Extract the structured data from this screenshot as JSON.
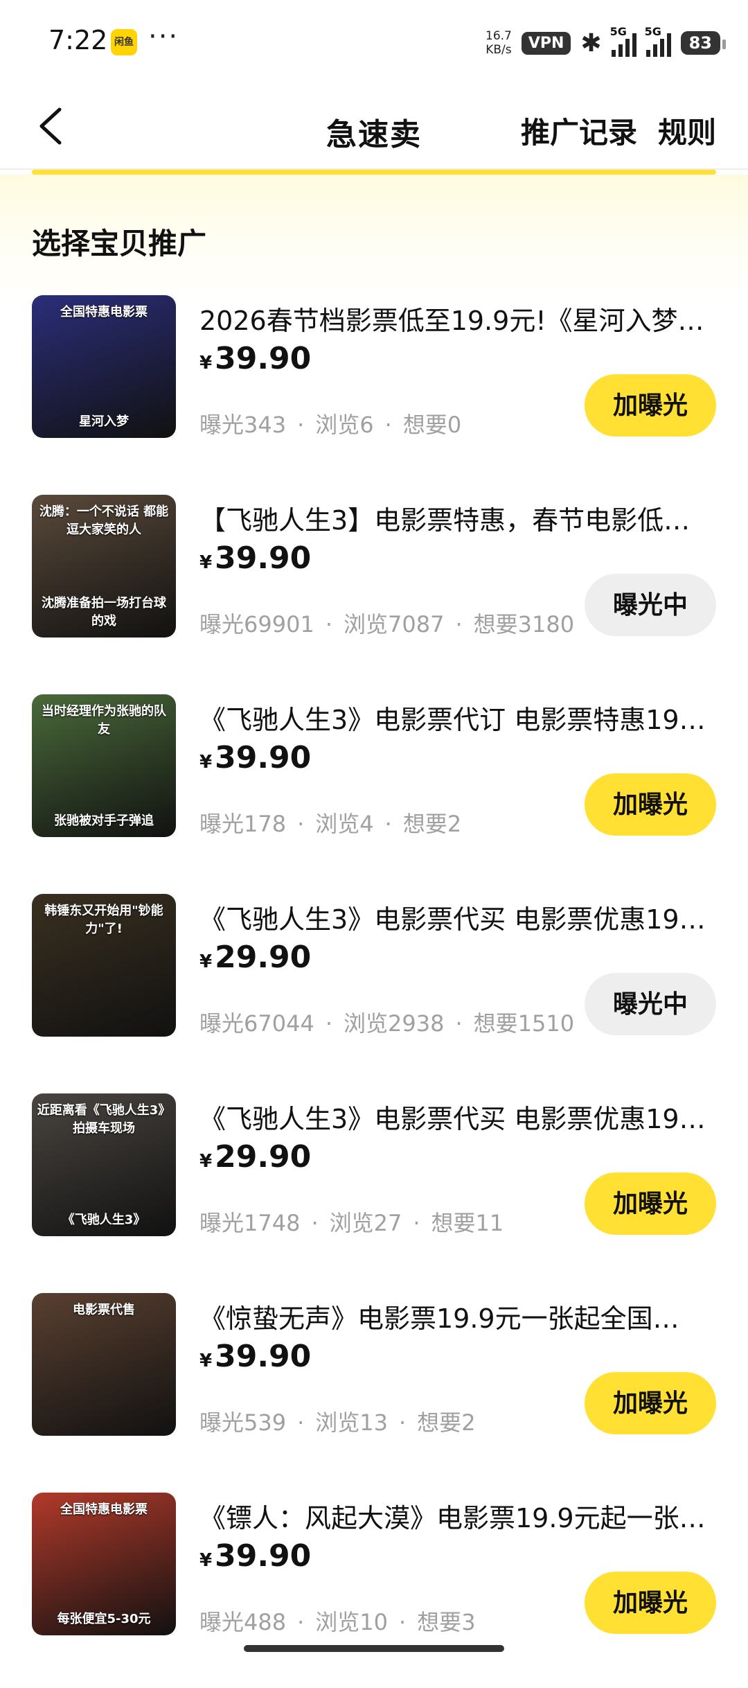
{
  "status_bar": {
    "time": "7:22",
    "app_icon_text": "闲鱼",
    "more": "···",
    "speed_value": "16.7",
    "speed_unit": "KB/s",
    "vpn": "VPN",
    "signal1_label": "5G",
    "signal2_label": "5G",
    "battery": "83"
  },
  "header": {
    "title": "急速卖",
    "link_records": "推广记录",
    "link_rules": "规则"
  },
  "section_title": "选择宝贝推广",
  "currency": "¥",
  "stat_labels": {
    "exposure": "曝光",
    "views": "浏览",
    "wants": "想要"
  },
  "dot": "·",
  "items": [
    {
      "title": "2026春节档影票低至19.9元!《星河入梦…",
      "price": "39.90",
      "exposure": "343",
      "views": "6",
      "wants": "0",
      "button": "加曝光",
      "button_state": "add",
      "thumb_caption_top": "全国特惠电影票",
      "thumb_caption_bottom": "星河入梦",
      "thumb_color": "#2b2e7a"
    },
    {
      "title": "【飞驰人生3】电影票特惠，春节电影低…",
      "price": "39.90",
      "exposure": "69901",
      "views": "7087",
      "wants": "3180",
      "button": "曝光中",
      "button_state": "running",
      "thumb_caption_top": "沈腾：一个不说话 都能逗大家笑的人",
      "thumb_caption_bottom": "沈腾准备拍一场打台球的戏",
      "thumb_color": "#5a4a3a"
    },
    {
      "title": "《飞驰人生3》电影票代订 电影票特惠19…",
      "price": "39.90",
      "exposure": "178",
      "views": "4",
      "wants": "2",
      "button": "加曝光",
      "button_state": "add",
      "thumb_caption_top": "当时经理作为张驰的队友",
      "thumb_caption_bottom": "张驰被对手子弹追",
      "thumb_color": "#4a6a3a"
    },
    {
      "title": "《飞驰人生3》电影票代买 电影票优惠19…",
      "price": "29.90",
      "exposure": "67044",
      "views": "2938",
      "wants": "1510",
      "button": "曝光中",
      "button_state": "running",
      "thumb_caption_top": "韩锤东又开始用\"钞能力\"了!",
      "thumb_caption_bottom": "",
      "thumb_color": "#3a3020"
    },
    {
      "title": "《飞驰人生3》电影票代买 电影票优惠19…",
      "price": "29.90",
      "exposure": "1748",
      "views": "27",
      "wants": "11",
      "button": "加曝光",
      "button_state": "add",
      "thumb_caption_top": "近距离看《飞驰人生3》拍摄车现场",
      "thumb_caption_bottom": "《飞驰人生3》",
      "thumb_color": "#4a4540"
    },
    {
      "title": "《惊蛰无声》电影票19.9元一张起全国…",
      "price": "39.90",
      "exposure": "539",
      "views": "13",
      "wants": "2",
      "button": "加曝光",
      "button_state": "add",
      "thumb_caption_top": "电影票代售",
      "thumb_caption_bottom": "",
      "thumb_color": "#5a4030"
    },
    {
      "title": "《镖人：风起大漠》电影票19.9元起一张…",
      "price": "39.90",
      "exposure": "488",
      "views": "10",
      "wants": "3",
      "button": "加曝光",
      "button_state": "add",
      "thumb_caption_top": "全国特惠电影票",
      "thumb_caption_bottom": "每张便宜5-30元",
      "thumb_color": "#b23a2a"
    }
  ],
  "colors": {
    "accent": "#ffe033",
    "muted": "#a0a0a0",
    "running_bg": "#eeeeee"
  }
}
